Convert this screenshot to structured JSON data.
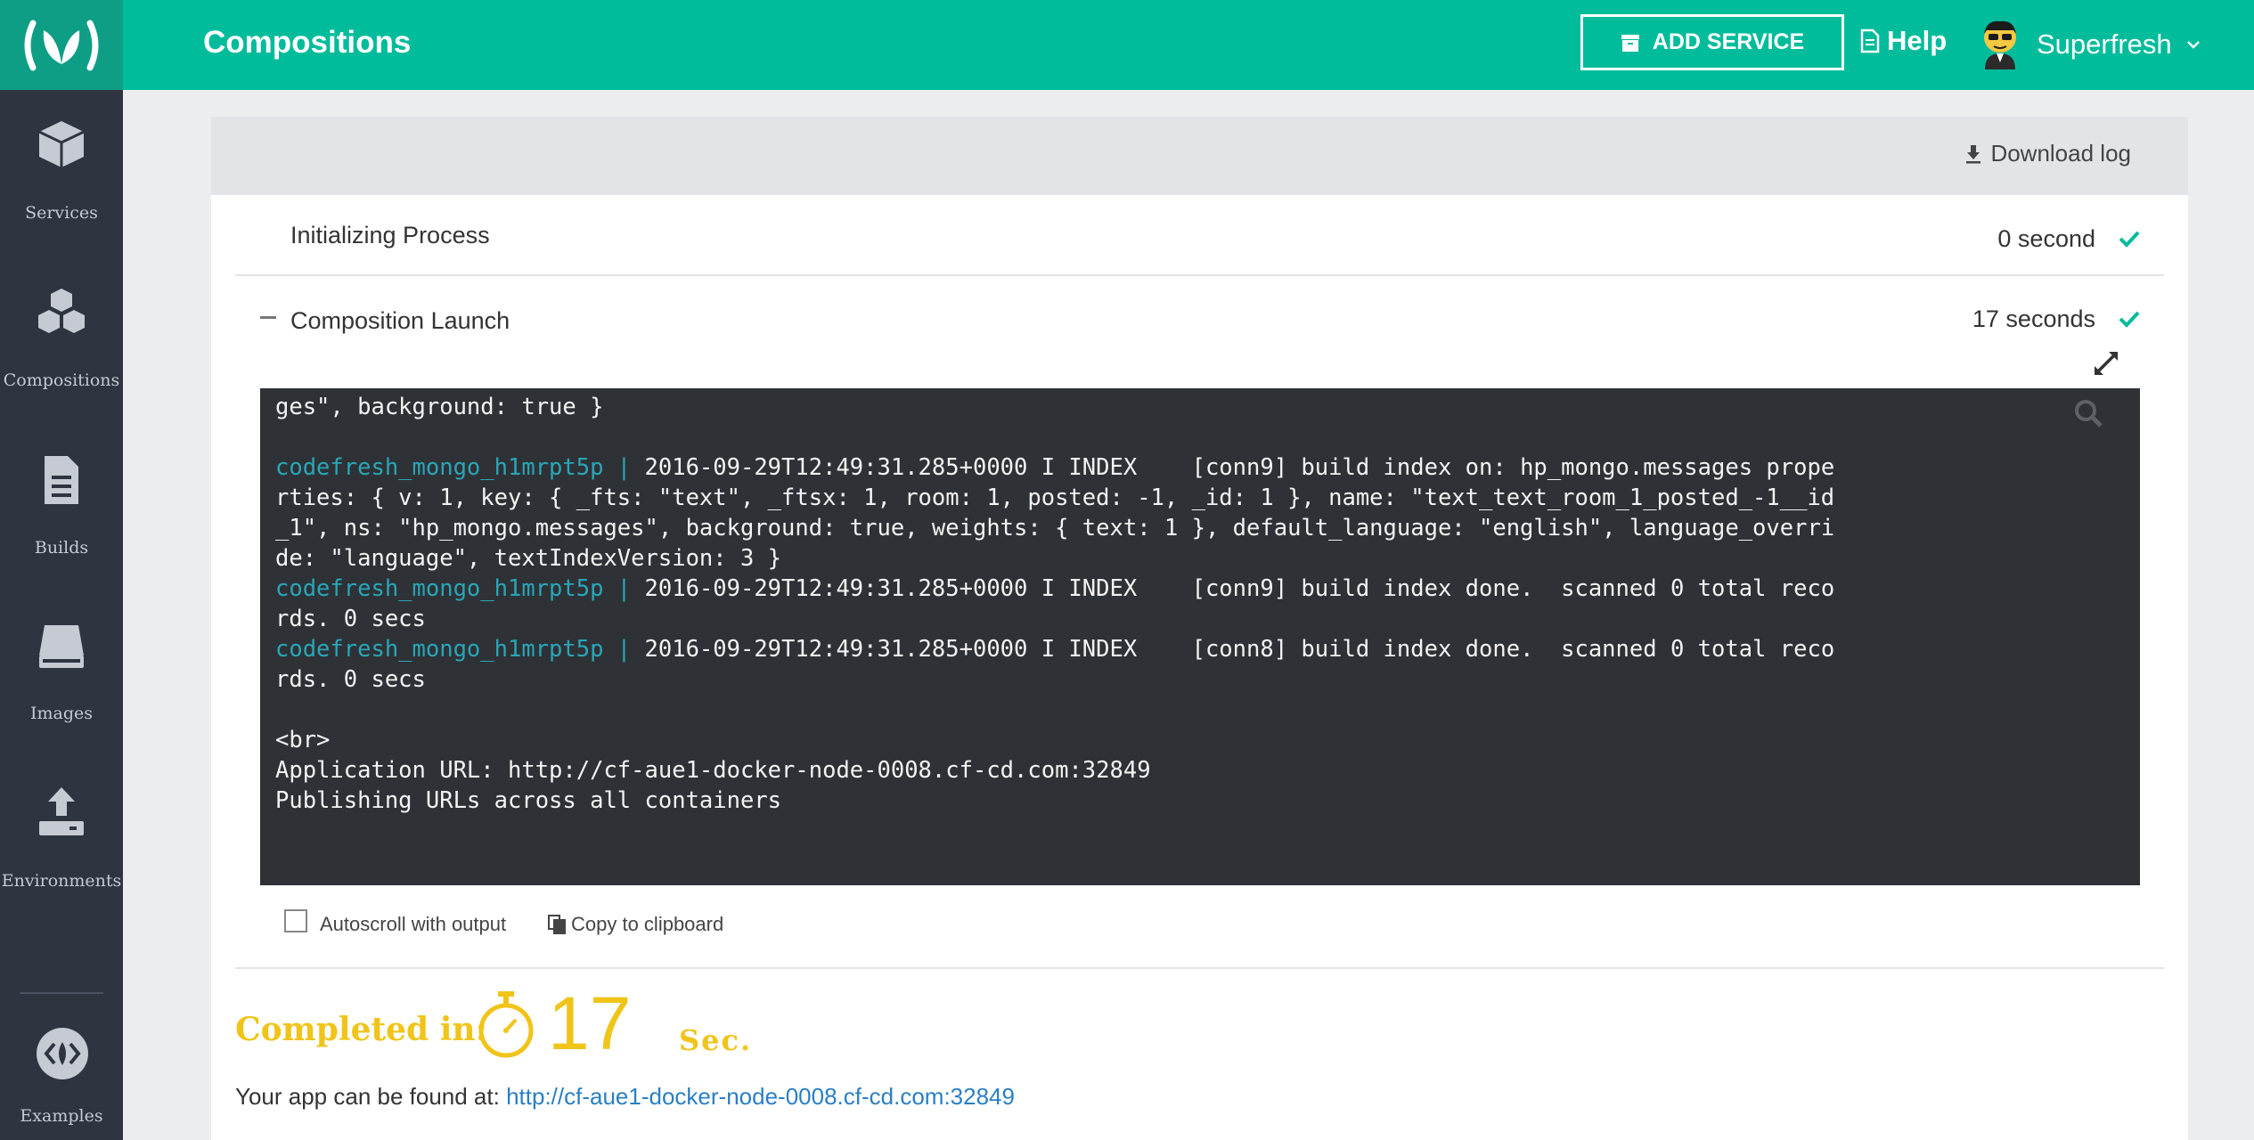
{
  "app": {
    "title": "Compositions",
    "accent_color": "#00bc9b",
    "logo_icon": "codefresh-logo-icon"
  },
  "sidebar": {
    "items": [
      {
        "label": "Services",
        "icon": "cube-icon"
      },
      {
        "label": "Compositions",
        "icon": "cubes-icon"
      },
      {
        "label": "Builds",
        "icon": "document-icon"
      },
      {
        "label": "Images",
        "icon": "drive-icon"
      },
      {
        "label": "Environments",
        "icon": "upload-icon"
      },
      {
        "label": "Examples",
        "icon": "code-icon"
      }
    ]
  },
  "header": {
    "add_service_label": "ADD SERVICE",
    "help_label": "Help",
    "user_name": "Superfresh"
  },
  "panel": {
    "download_log_label": "Download log",
    "steps": [
      {
        "title": "Initializing Process",
        "time": "0 second",
        "status": "success"
      },
      {
        "title": "Composition Launch",
        "time": "17 seconds",
        "status": "success"
      }
    ],
    "terminal": {
      "prefix": "codefresh_mongo_h1mrpt5p | ",
      "lines": [
        {
          "prefix": "",
          "text": "ges\", background: true }"
        },
        {
          "prefix": "",
          "text": ""
        },
        {
          "prefix": "codefresh_mongo_h1mrpt5p | ",
          "text": "2016-09-29T12:49:31.285+0000 I INDEX    [conn9] build index on: hp_mongo.messages prope"
        },
        {
          "prefix": "",
          "text": "rties: { v: 1, key: { _fts: \"text\", _ftsx: 1, room: 1, posted: -1, _id: 1 }, name: \"text_text_room_1_posted_-1__id"
        },
        {
          "prefix": "",
          "text": "_1\", ns: \"hp_mongo.messages\", background: true, weights: { text: 1 }, default_language: \"english\", language_overri"
        },
        {
          "prefix": "",
          "text": "de: \"language\", textIndexVersion: 3 }"
        },
        {
          "prefix": "codefresh_mongo_h1mrpt5p | ",
          "text": "2016-09-29T12:49:31.285+0000 I INDEX    [conn9] build index done.  scanned 0 total reco"
        },
        {
          "prefix": "",
          "text": "rds. 0 secs"
        },
        {
          "prefix": "codefresh_mongo_h1mrpt5p | ",
          "text": "2016-09-29T12:49:31.285+0000 I INDEX    [conn8] build index done.  scanned 0 total reco"
        },
        {
          "prefix": "",
          "text": "rds. 0 secs"
        },
        {
          "prefix": "",
          "text": ""
        },
        {
          "prefix": "",
          "text": "<br>"
        },
        {
          "prefix": "",
          "text": "Application URL: http://cf-aue1-docker-node-0008.cf-cd.com:32849"
        },
        {
          "prefix": "",
          "text": "Publishing URLs across all containers"
        }
      ]
    },
    "autoscroll_label": "Autoscroll with output",
    "autoscroll_checked": false,
    "copy_label": "Copy to clipboard",
    "completed": {
      "label": "Completed in:",
      "value": "17",
      "unit": "Sec."
    },
    "app_found_text": "Your app can be found at: ",
    "app_url": "http://cf-aue1-docker-node-0008.cf-cd.com:32849"
  },
  "colors": {
    "sidebar_bg": "#2e3440",
    "terminal_bg": "#2e3236",
    "terminal_prefix": "#2aa6b8",
    "completed": "#f0c419",
    "check": "#00bc9b",
    "link": "#2a7fc4"
  }
}
